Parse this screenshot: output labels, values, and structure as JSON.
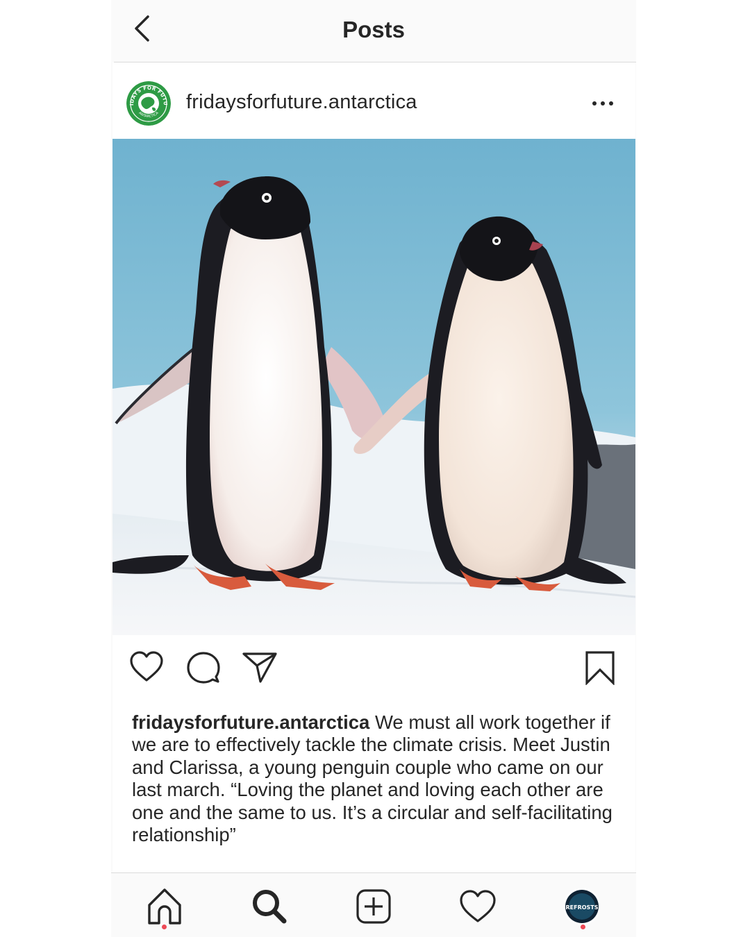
{
  "header": {
    "title": "Posts"
  },
  "post": {
    "username": "fridaysforfuture.antarctica",
    "avatar": {
      "ring_text": "FRIDAYS FOR FUTURE",
      "bottom_text": "ANTARCTICA",
      "color": "#2e9b45"
    },
    "image": {
      "subject": "two penguins holding flippers on snow",
      "sky_color": "#7fbad3",
      "snow_color": "#f1f3f6"
    },
    "caption": {
      "user": "fridaysforfuture.antarctica",
      "text": "We must all work together if we are to effectively tackle the climate crisis. Meet Justin and Clarissa, a young penguin couple who came on our last march. “Loving the planet and loving each other are one and the same to us. It’s a circular and self-facilitating relationship”"
    },
    "actions": [
      "heart-icon",
      "comment-icon",
      "share-icon",
      "bookmark-icon"
    ]
  },
  "tabbar": {
    "items": [
      "home-icon",
      "search-icon",
      "add-post-icon",
      "activity-heart-icon",
      "profile-avatar"
    ],
    "profile_avatar_text": "REFROSTS",
    "notification_dot_color": "#ed4956"
  }
}
